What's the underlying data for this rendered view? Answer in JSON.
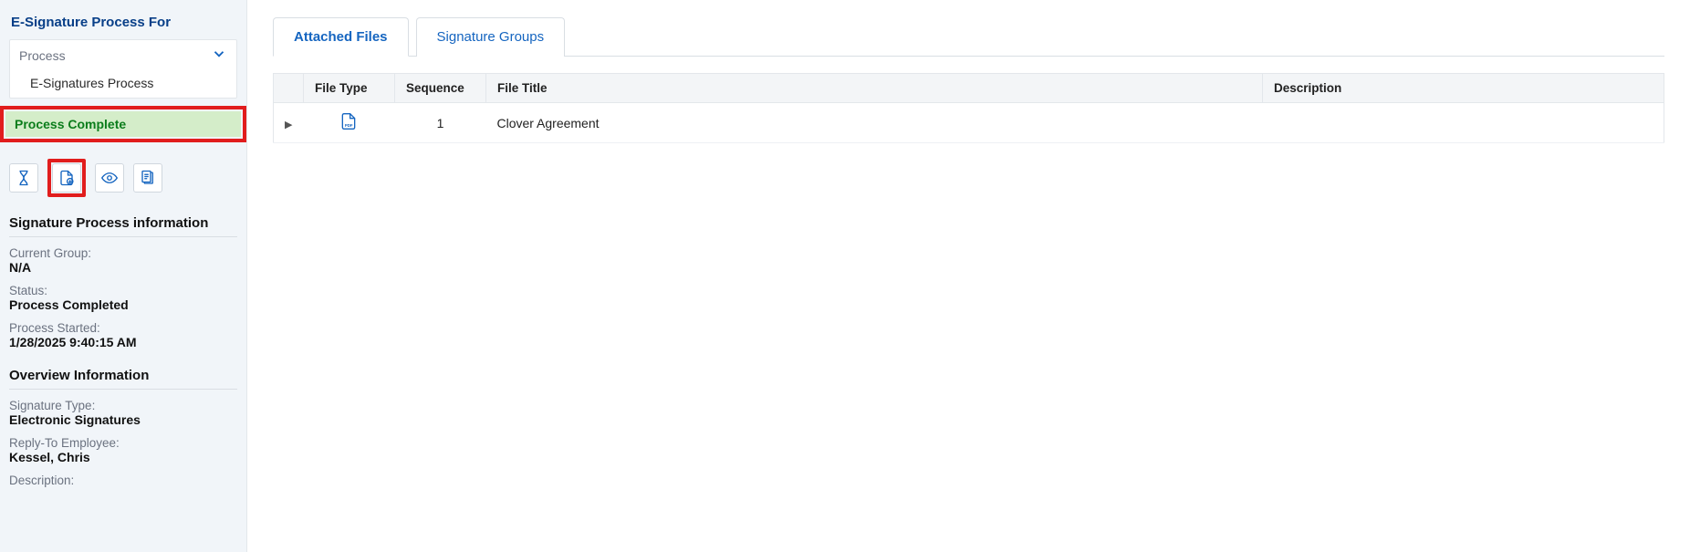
{
  "sidebar": {
    "title": "E-Signature Process For",
    "process_dropdown": {
      "label": "Process",
      "selected": "E-Signatures Process"
    },
    "status_banner": "Process Complete",
    "icons": {
      "hourglass": "hourglass-icon",
      "download": "file-download-icon",
      "eye": "eye-icon",
      "clipboard": "clipboard-icon"
    },
    "section1_title": "Signature Process information",
    "current_group_label": "Current Group:",
    "current_group_value": "N/A",
    "status_label": "Status:",
    "status_value": "Process Completed",
    "started_label": "Process Started:",
    "started_value": "1/28/2025 9:40:15 AM",
    "section2_title": "Overview Information",
    "sig_type_label": "Signature Type:",
    "sig_type_value": "Electronic Signatures",
    "reply_to_label": "Reply-To Employee:",
    "reply_to_value": "Kessel, Chris",
    "description_label": "Description:"
  },
  "main": {
    "tabs": [
      "Attached Files",
      "Signature Groups"
    ],
    "active_tab_index": 0,
    "columns": {
      "filetype": "File Type",
      "sequence": "Sequence",
      "title": "File Title",
      "description": "Description"
    },
    "rows": [
      {
        "sequence": "1",
        "title": "Clover Agreement",
        "description": ""
      }
    ]
  }
}
